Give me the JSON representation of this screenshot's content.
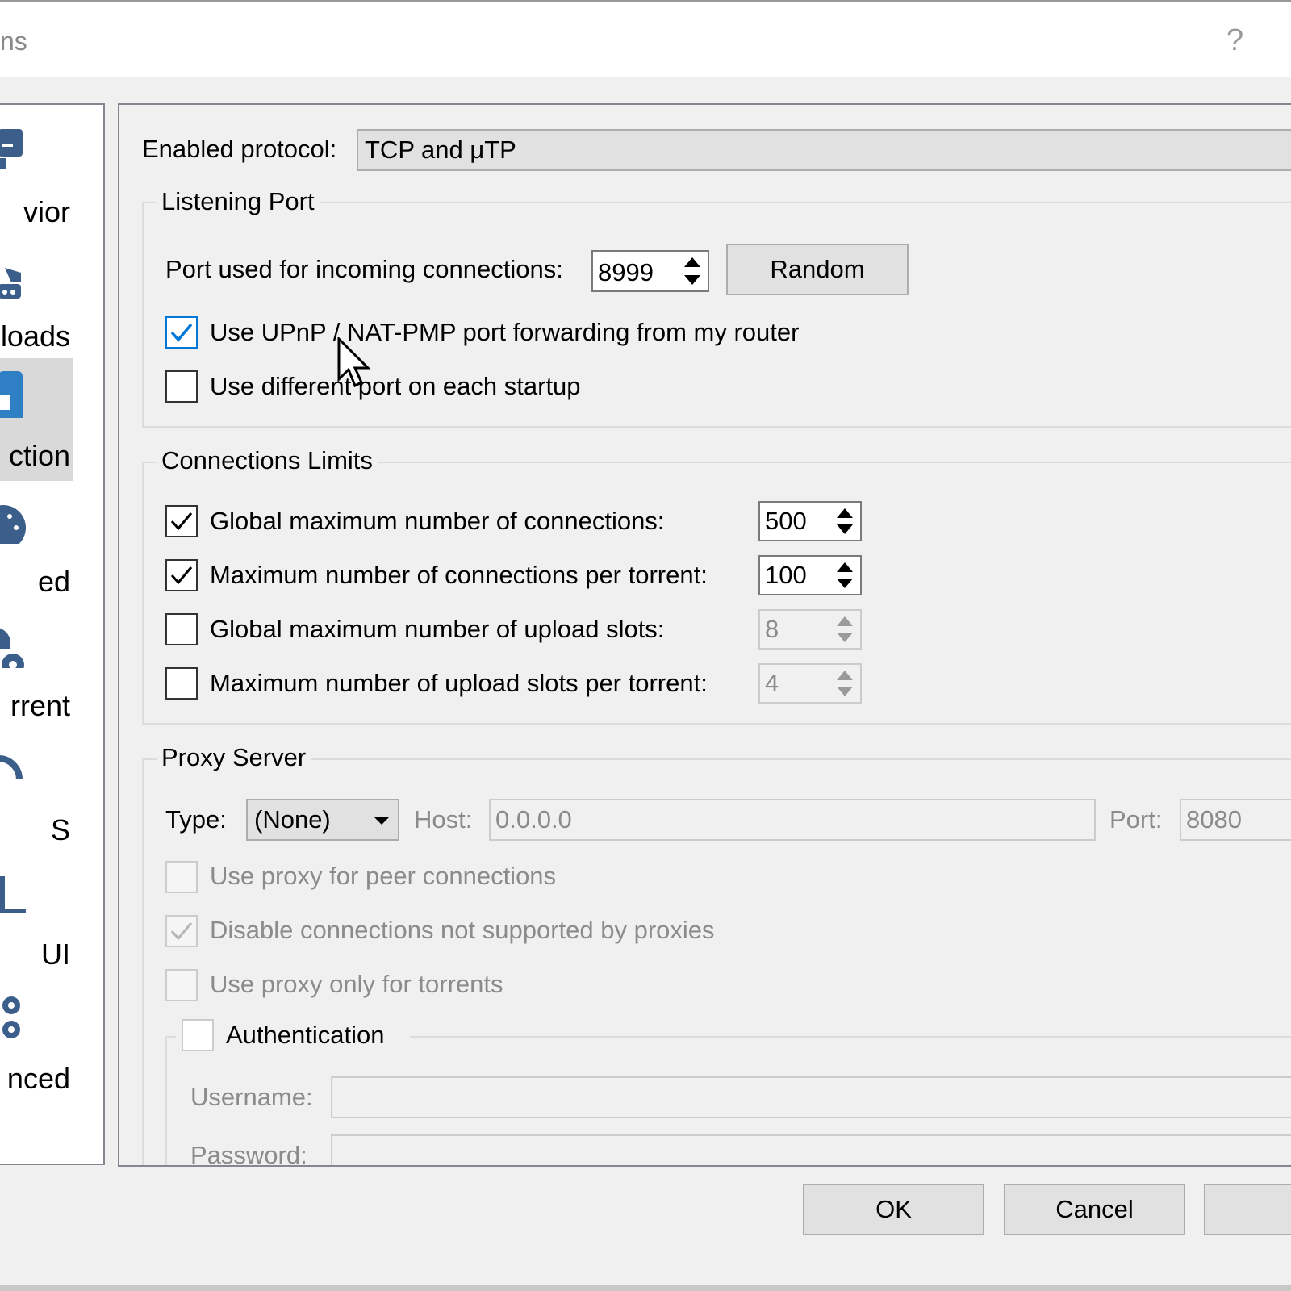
{
  "window": {
    "title_fragment": "ns",
    "help_glyph": "?"
  },
  "sidebar": {
    "items": [
      {
        "label": "vior",
        "icon": "monitor-icon",
        "selected": false
      },
      {
        "label": "loads",
        "icon": "downloads-icon",
        "selected": false
      },
      {
        "label": "ction",
        "icon": "connection-icon",
        "selected": true
      },
      {
        "label": "ed",
        "icon": "speed-gauge-icon",
        "selected": false
      },
      {
        "label": "rrent",
        "icon": "bittorrent-gear-icon",
        "selected": false
      },
      {
        "label": "S",
        "icon": "rss-icon",
        "selected": false
      },
      {
        "label": "UI",
        "icon": "web-ui-icon",
        "selected": false
      },
      {
        "label": "nced",
        "icon": "advanced-gears-icon",
        "selected": false
      }
    ]
  },
  "protocol": {
    "label": "Enabled protocol:",
    "value": "TCP and μTP"
  },
  "listening_port": {
    "title": "Listening Port",
    "port_label": "Port used for incoming connections:",
    "port_value": "8999",
    "random_button": "Random",
    "upnp_label": "Use UPnP / NAT-PMP port forwarding from my router",
    "upnp_checked": true,
    "diff_port_label": "Use different port on each startup",
    "diff_port_checked": false
  },
  "connection_limits": {
    "title": "Connections Limits",
    "rows": [
      {
        "label": "Global maximum number of connections:",
        "value": "500",
        "checked": true
      },
      {
        "label": "Maximum number of connections per torrent:",
        "value": "100",
        "checked": true
      },
      {
        "label": "Global maximum number of upload slots:",
        "value": "8",
        "checked": false
      },
      {
        "label": "Maximum number of upload slots per torrent:",
        "value": "4",
        "checked": false
      }
    ]
  },
  "proxy": {
    "title": "Proxy Server",
    "type_label": "Type:",
    "type_value": "(None)",
    "host_label": "Host:",
    "host_value": "0.0.0.0",
    "port_label": "Port:",
    "port_value": "8080",
    "peer_label": "Use proxy for peer connections",
    "disable_label": "Disable connections not supported by proxies",
    "torrents_label": "Use proxy only for torrents",
    "auth_label": "Authentication",
    "username_label": "Username:",
    "password_label": "Password:"
  },
  "buttons": {
    "ok": "OK",
    "cancel": "Cancel"
  },
  "colors": {
    "accent": "#0078d7",
    "selection": "#d9d9d9",
    "icon_blue": "#3b5f8a"
  }
}
